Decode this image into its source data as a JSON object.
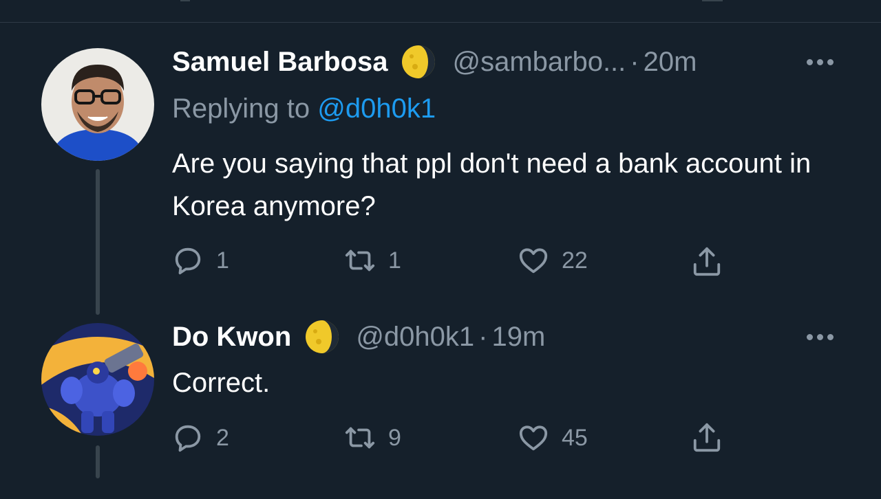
{
  "tweets": [
    {
      "author_name": "Samuel Barbosa",
      "handle": "@sambarbo...",
      "separator": "·",
      "time": "20m",
      "replying_prefix": "Replying to ",
      "replying_to": "@d0h0k1",
      "text": "Are you saying that ppl don't need a bank account in Korea anymore?",
      "replies": "1",
      "retweets": "1",
      "likes": "22",
      "badge_icon": "moon-badge-icon",
      "avatar": "avatar-photo-man-with-glasses"
    },
    {
      "author_name": "Do Kwon",
      "handle": "@d0h0k1",
      "separator": "·",
      "time": "19m",
      "text": "Correct.",
      "replies": "2",
      "retweets": "9",
      "likes": "45",
      "badge_icon": "moon-badge-icon",
      "avatar": "avatar-armored-character"
    }
  ],
  "colors": {
    "background": "#15202b",
    "secondary_text": "#8b98a5",
    "link": "#1d9bf0",
    "divider": "#38444d"
  }
}
